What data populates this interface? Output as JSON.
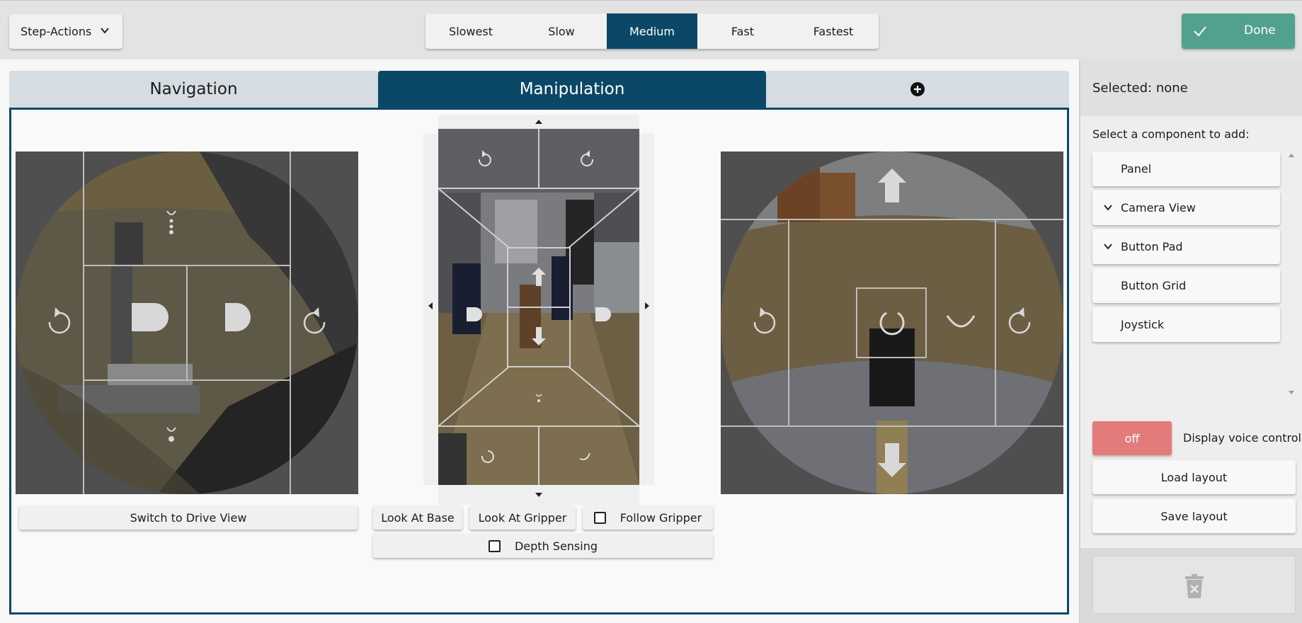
{
  "toolbar": {
    "step_actions_label": "Step-Actions",
    "speeds": [
      "Slowest",
      "Slow",
      "Medium",
      "Fast",
      "Fastest"
    ],
    "active_speed": "Medium",
    "done_label": "Done"
  },
  "tabs": {
    "navigation": "Navigation",
    "manipulation": "Manipulation",
    "active": "Manipulation"
  },
  "panel": {
    "switch_drive_view": "Switch to Drive View",
    "look_at_base": "Look At Base",
    "look_at_gripper": "Look At Gripper",
    "follow_gripper": "Follow Gripper",
    "depth_sensing": "Depth Sensing"
  },
  "sidebar": {
    "selected": "Selected: none",
    "add_label": "Select a component to add:",
    "components": [
      {
        "label": "Panel",
        "expandable": false
      },
      {
        "label": "Camera View",
        "expandable": true
      },
      {
        "label": "Button Pad",
        "expandable": true
      },
      {
        "label": "Button Grid",
        "expandable": false
      },
      {
        "label": "Joystick",
        "expandable": false
      }
    ],
    "voice_toggle": "off",
    "voice_label": "Display voice control",
    "load_layout": "Load layout",
    "save_layout": "Save layout"
  },
  "colors": {
    "primary": "#0b4867",
    "done": "#52a18e",
    "off": "#e47b7b"
  }
}
